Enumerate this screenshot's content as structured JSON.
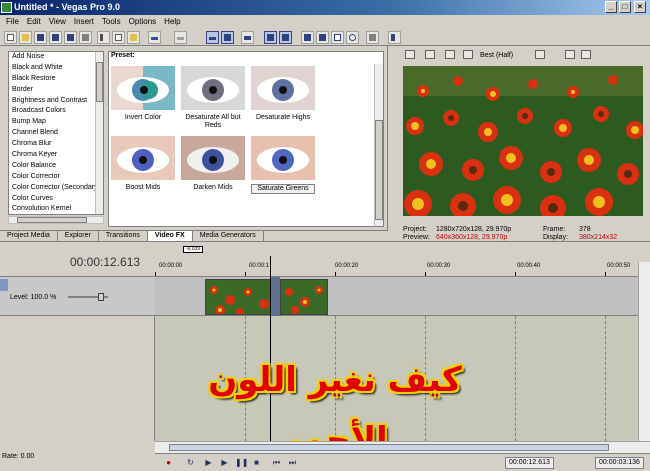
{
  "window": {
    "title": "Untitled * - Vegas Pro 9.0"
  },
  "menu": [
    "File",
    "Edit",
    "View",
    "Insert",
    "Tools",
    "Options",
    "Help"
  ],
  "fx_list": [
    "Add Noise",
    "Black and White",
    "Black Restore",
    "Border",
    "Brightness and Contrast",
    "Broadcast Colors",
    "Bump Map",
    "Channel Blend",
    "Chroma Blur",
    "Chroma Keyer",
    "Color Balance",
    "Color Corrector",
    "Color Corrector (Secondary)",
    "Color Curves",
    "Convolution Kernel"
  ],
  "preset": {
    "label": "Preset:",
    "items": [
      "Invert Color",
      "Desaturate All but Reds",
      "Desaturate Highs",
      "Boost Mids",
      "Darken Mids",
      "Saturate Greens"
    ]
  },
  "tabs": [
    "Project Media",
    "Explorer",
    "Transitions",
    "Video FX",
    "Media Generators"
  ],
  "preview": {
    "quality": "Best (Half)",
    "project_label": "Project:",
    "project_value": "1280x720x128, 29.970p",
    "preview_label": "Preview:",
    "preview_value": "640x360x128, 29.970p",
    "frame_label": "Frame:",
    "frame_value": "378",
    "display_label": "Display:",
    "display_value": "380x214x32"
  },
  "timeline": {
    "timecode": "00:00:12.613",
    "loop_marker": "-6.039",
    "ruler_ticks": [
      "00:00:00",
      "00:00:1",
      "00:00:20",
      "00:00:30",
      "00:00:40",
      "00:00:50"
    ],
    "level": "Level: 100.0 %",
    "rate": "Rate: 0.00",
    "cursor_time": "00:00:12.613",
    "end_time": "00:00:03:136"
  },
  "overlay_text": "كيف نغير اللون الأحمر",
  "colors": {
    "title_bar": "#0a246a",
    "overlay": "#e00000",
    "overlay_outline": "#f0d000"
  }
}
